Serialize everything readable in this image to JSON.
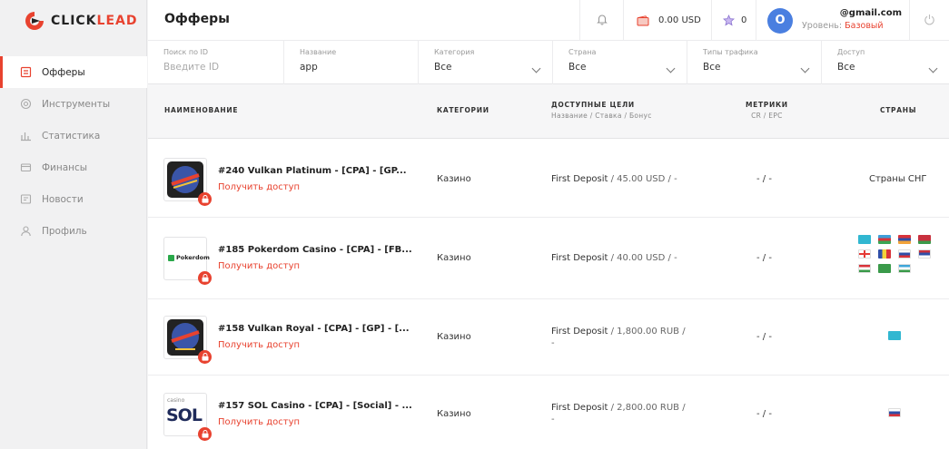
{
  "brand": {
    "name_dark": "CLICK",
    "name_accent": "LEAD"
  },
  "sidebar": {
    "items": [
      {
        "label": "Офферы",
        "icon": "offers-icon",
        "active": true
      },
      {
        "label": "Инструменты",
        "icon": "tools-icon"
      },
      {
        "label": "Статистика",
        "icon": "stats-icon"
      },
      {
        "label": "Финансы",
        "icon": "finance-icon"
      },
      {
        "label": "Новости",
        "icon": "news-icon"
      },
      {
        "label": "Профиль",
        "icon": "profile-icon"
      }
    ]
  },
  "header": {
    "title": "Офферы",
    "balance": "0.00 USD",
    "stars": "0",
    "avatar_letter": "O",
    "email": "@gmail.com",
    "level_label": "Уровень:",
    "level_value": "Базовый"
  },
  "filters": [
    {
      "label": "Поиск по ID",
      "value": "",
      "placeholder": "Введите ID"
    },
    {
      "label": "Название",
      "value": "app"
    },
    {
      "label": "Категория",
      "value": "Все"
    },
    {
      "label": "Страна",
      "value": "Все"
    },
    {
      "label": "Типы трафика",
      "value": "Все"
    },
    {
      "label": "Доступ",
      "value": "Все"
    }
  ],
  "table": {
    "columns": {
      "name": "НАИМЕНОВАНИЕ",
      "categories": "КАТЕГОРИИ",
      "goals": "ДОСТУПНЫЕ ЦЕЛИ",
      "goals_sub": "Название / Ставка / Бонус",
      "metrics": "МЕТРИКИ",
      "metrics_sub": "CR / EPC",
      "countries": "СТРАНЫ"
    },
    "rows": [
      {
        "name": "#240 Vulkan Platinum - [CPA] - [GP...",
        "access": "Получить доступ",
        "category": "Казино",
        "goal_name": "First Deposit",
        "goal_rest": " / 45.00 USD / -",
        "metrics": "- / -",
        "countries_text": "Страны СНГ",
        "flags": []
      },
      {
        "name": "#185 Pokerdom Casino - [CPA] - [FB...",
        "access": "Получить доступ",
        "category": "Казино",
        "goal_name": "First Deposit",
        "goal_rest": " / 40.00 USD / -",
        "metrics": "- / -",
        "countries_text": "",
        "flags": [
          "kz",
          "az",
          "am",
          "by",
          "ge",
          "md",
          "ru",
          "rs",
          "tj",
          "tm",
          "uz"
        ],
        "thumb_label": "Pokerdom"
      },
      {
        "name": "#158 Vulkan Royal - [CPA] - [GP] - [...",
        "access": "Получить доступ",
        "category": "Казино",
        "goal_name": "First Deposit",
        "goal_rest": " / 1,800.00 RUB / -",
        "metrics": "- / -",
        "countries_text": "",
        "flags": [
          "kz"
        ]
      },
      {
        "name": "#157 SOL Casino - [CPA] - [Social] - ...",
        "access": "Получить доступ",
        "category": "Казино",
        "goal_name": "First Deposit",
        "goal_rest": " / 2,800.00 RUB / -",
        "metrics": "- / -",
        "countries_text": "",
        "flags": [
          "ru"
        ],
        "thumb_label": "SOL",
        "thumb_small": "casino"
      }
    ]
  },
  "colors": {
    "accent": "#e8422f",
    "avatar": "#4a7fe0"
  }
}
